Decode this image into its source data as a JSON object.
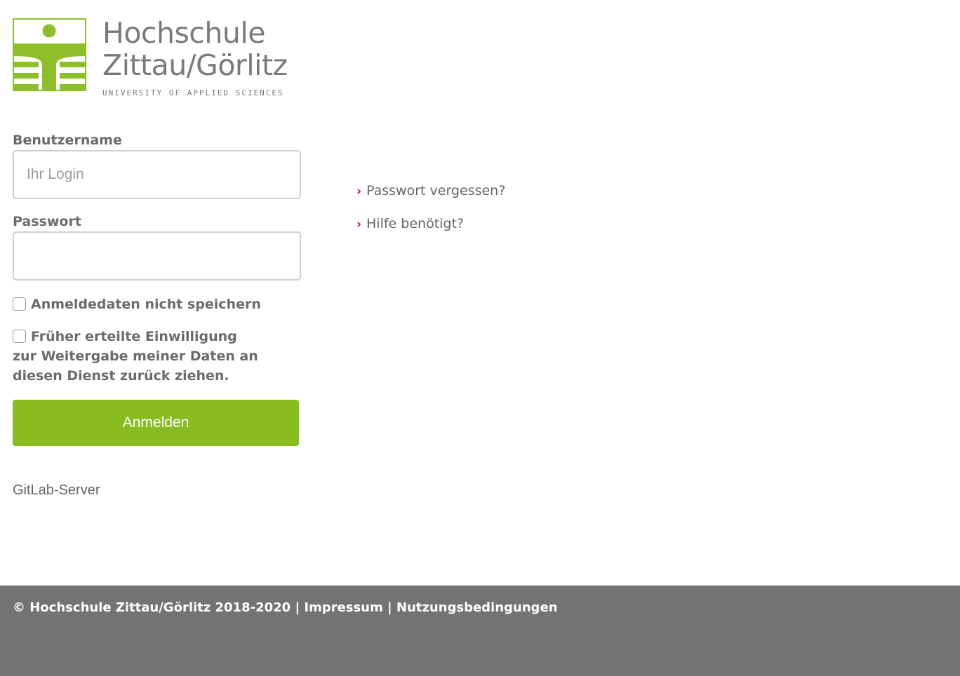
{
  "logo": {
    "line1": "Hochschule",
    "line2": "Zittau/Görlitz",
    "line3": "UNIVERSITY OF APPLIED SCIENCES",
    "color": "#8dbf2b"
  },
  "form": {
    "username_label": "Benutzername",
    "username_placeholder": "Ihr Login",
    "username_value": "",
    "password_label": "Passwort",
    "password_value": "",
    "checkbox_1_label": "Anmeldedaten nicht speichern",
    "checkbox_2_label": "Früher erteilte Einwilligung zur Weitergabe meiner Daten an diesen Dienst zurück ziehen.",
    "submit_label": "Anmelden",
    "submit_color": "#88bc21"
  },
  "service_name": "GitLab-Server",
  "links": {
    "forgot_password": "Passwort vergessen?",
    "need_help": "Hilfe benötigt?",
    "icon": "chevron-right-icon",
    "icon_color": "#c0151b"
  },
  "footer": {
    "copyright": "© Hochschule Zittau/Görlitz 2018-2020",
    "separator": "|",
    "impressum": "Impressum",
    "terms": "Nutzungsbedingungen",
    "background": "#737373"
  }
}
